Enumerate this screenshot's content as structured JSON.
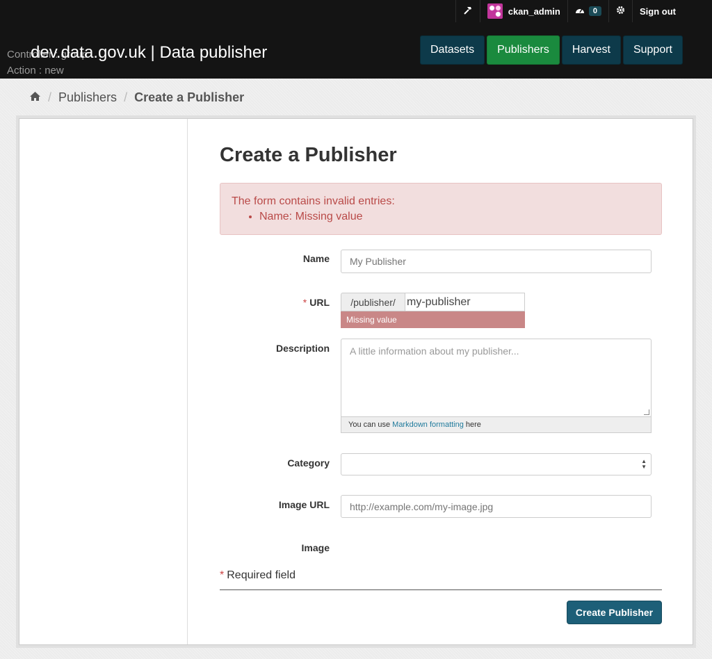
{
  "account": {
    "admin_icon": "hammer-icon",
    "username": "ckan_admin",
    "dashboard_icon": "dashboard-icon",
    "notification_count": "0",
    "settings_icon": "gear-icon",
    "signout_label": "Sign out"
  },
  "debug": {
    "controller_text": "Controller : group",
    "action_text": "Action : new"
  },
  "site_title": "dev.data.gov.uk | Data publisher",
  "nav": {
    "items": [
      {
        "label": "Datasets",
        "active": false
      },
      {
        "label": "Publishers",
        "active": true
      },
      {
        "label": "Harvest",
        "active": false
      },
      {
        "label": "Support",
        "active": false
      }
    ]
  },
  "breadcrumb": {
    "home_icon": "home-icon",
    "items": [
      "Publishers",
      "Create a Publisher"
    ]
  },
  "form": {
    "heading": "Create a Publisher",
    "alert": {
      "title": "The form contains invalid entries:",
      "errors": [
        "Name: Missing value"
      ]
    },
    "name": {
      "label": "Name",
      "placeholder": "My Publisher",
      "value": ""
    },
    "url": {
      "label": "URL",
      "required_mark": "*",
      "prefix": "/publisher/",
      "value": "my-publisher",
      "error": "Missing value"
    },
    "description": {
      "label": "Description",
      "placeholder": "A little information about my publisher...",
      "note_before": "You can use",
      "note_link": "Markdown formatting",
      "note_after": "here"
    },
    "category": {
      "label": "Category",
      "value": ""
    },
    "image_url": {
      "label": "Image URL",
      "placeholder": "http://example.com/my-image.jpg"
    },
    "image": {
      "label": "Image"
    },
    "required_note": {
      "mark": "*",
      "text": "Required field"
    },
    "submit_label": "Create Publisher"
  },
  "colors": {
    "header_bg": "#141414",
    "nav_bg": "#0d3a4a",
    "nav_active": "#1a8a3e",
    "alert_bg": "#f2dede",
    "alert_text": "#b94a48",
    "submit_bg": "#1d5f78"
  }
}
